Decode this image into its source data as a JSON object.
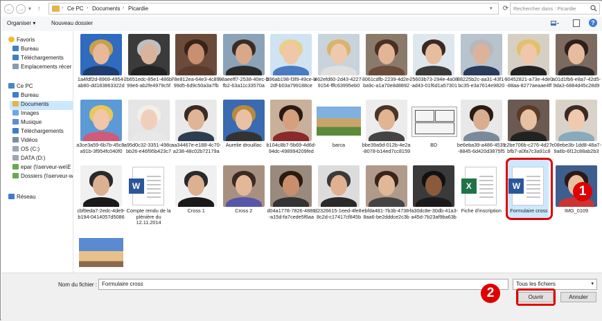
{
  "breadcrumb": [
    "Ce PC",
    "Documents",
    "Picardie"
  ],
  "search": {
    "placeholder": "Rechercher dans : Picardie"
  },
  "toolbar": {
    "organize": "Organiser ▾",
    "new_folder": "Nouveau dossier"
  },
  "nav": {
    "favorites": "Favoris",
    "fav_items": [
      "Bureau",
      "Téléchargements",
      "Emplacements récer"
    ],
    "thispc": "Ce PC",
    "pc_items": [
      "Bureau",
      "Documents",
      "Images",
      "Musique",
      "Téléchargements",
      "Vidéos",
      "OS (C:)",
      "DATA (D:)",
      "epar (\\\\serveur-we\\E",
      "Dossiers (\\\\serveur-w"
    ],
    "network": "Réseau"
  },
  "files": [
    "1a4fdf2d-8969-4954-ab80-dd183863322d",
    "2b651edc-85e1-486b-99e6-ab2fe4979c5f",
    "78e812ea-64e3-4c89-99d5-6d9c50a3a7fb",
    "98aeeff7-2538-40ec-bfb2-63a11c33570a",
    "396ab198-f3f9-49ce-b2df-b03a799188ce",
    "462efd60-2d43-4227-9154-fffc63995eb0",
    "3061cdfb-2239-4d2e-ba9c-a1a70e8d8892",
    "25603b73-294e-4a08-ad43-01f6d1a57301",
    "88225b2c-aa31-43f1-bc35-e3a7614e9820",
    "90452821-a73e-4de0-88aa-8277aeaae4ff",
    "a01d1fb6-e8a7-42d5-9da3-6884d45c28d9",
    "a3ce3a59-6b7b-45c8-a91b-3f954fc040f0",
    "a95d0c32-3351-498c-bb26-e46f95b423c7",
    "aa34467e-e188-4c70-a238-48c02b72179a",
    "Aurelie drouillac",
    "b104c8b7-5b69-4d6d-94dc-498994209fed",
    "barca",
    "bbe39a9d-012b-4e2a-8078-b14ed7cc8159",
    "BD",
    "be6eba39-a486-4539-8845-6d420d3875f5",
    "c2be706b-c276-4d27-bfb7-a0fa7c3a91c8",
    "c08ebe3b-1dd8-48a7-9a6b-6f12c88ab2b3",
    "cbf9eda7-2edc-4de9-b194-0414057d5086",
    "Compte rendu de la plénière du 12.11.2014",
    "Cross 1",
    "Cross 2",
    "d04a1778-7826-4886-a15d-fa7cede5f6aa",
    "d2326615-1eed-4fe8-8c2d-c17417cf845b",
    "ebfda481-7b3b-4738-8aa6-be2dddce2c3b",
    "fa30dc8e-30db-41a3-a45d-7b23af9ba63b",
    "Fiche d'inscription",
    "Formulaire cross",
    "IMG_0109",
    "madrid"
  ],
  "bottom": {
    "filename_label": "Nom du fichier :",
    "filename_value": "Formulaire cross",
    "filetype_value": "Tous les fichiers",
    "open_label": "Ouvrir",
    "cancel_label": "Annuler"
  },
  "callouts": {
    "one": "1",
    "two": "2"
  },
  "colors": {
    "highlight": "#e00000",
    "selection": "#cce8ff",
    "word_blue": "#2b579a",
    "excel_green": "#217346"
  }
}
